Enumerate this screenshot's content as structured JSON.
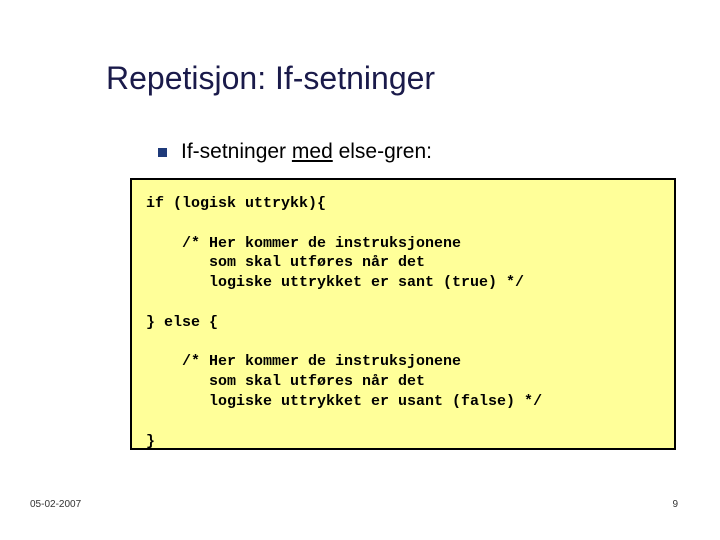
{
  "slide": {
    "title": "Repetisjon: If-setninger",
    "bullet_text_pre": "If-setninger ",
    "bullet_text_under": "med",
    "bullet_text_post": " else-gren:",
    "code": "if (logisk uttrykk){\n\n    /* Her kommer de instruksjonene\n       som skal utføres når det\n       logiske uttrykket er sant (true) */\n\n} else {\n\n    /* Her kommer de instruksjonene\n       som skal utføres når det\n       logiske uttrykket er usant (false) */\n\n}",
    "footer_date": "05-02-2007",
    "footer_page": "9"
  }
}
